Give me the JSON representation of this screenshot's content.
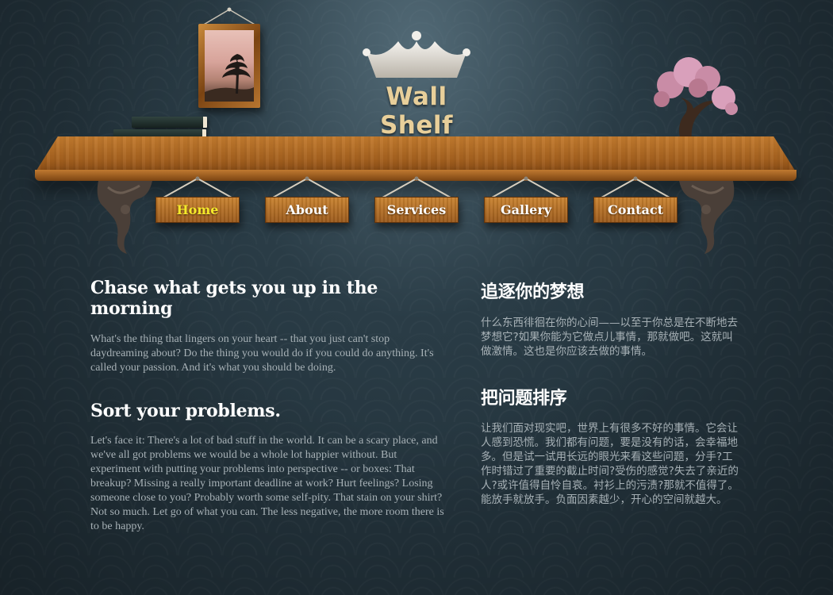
{
  "site": {
    "logo_text": "Wall Shelf",
    "logo_icon": "crown-icon"
  },
  "nav": {
    "items": [
      {
        "label": "Home",
        "active": true
      },
      {
        "label": "About",
        "active": false
      },
      {
        "label": "Services",
        "active": false
      },
      {
        "label": "Gallery",
        "active": false
      },
      {
        "label": "Contact",
        "active": false
      }
    ],
    "active_color": "#f5e92a"
  },
  "content": {
    "left": [
      {
        "heading": "Chase what gets you up in the morning",
        "body": "What's the thing that lingers on your heart -- that you just can't stop daydreaming about? Do the thing you would do if you could do anything. It's called your passion. And it's what you should be doing."
      },
      {
        "heading": "Sort your problems.",
        "body": "Let's face it: There's a lot of bad stuff in the world. It can be a scary place, and we've all got problems we would be a whole lot happier without. But experiment with putting your problems into perspective -- or boxes: That breakup? Missing a really important deadline at work? Hurt feelings? Losing someone close to you? Probably worth some self-pity. That stain on your shirt? Not so much. Let go of what you can. The less negative, the more room there is to be happy."
      }
    ],
    "right": [
      {
        "heading": "追逐你的梦想",
        "body": "什么东西徘徊在你的心间——以至于你总是在不断地去梦想它?如果你能为它做点儿事情，那就做吧。这就叫做激情。这也是你应该去做的事情。"
      },
      {
        "heading": "把问题排序",
        "body": "让我们面对现实吧，世界上有很多不好的事情。它会让人感到恐慌。我们都有问题，要是没有的话，会幸福地多。但是试一试用长远的眼光来看这些问题，分手?工作时错过了重要的截止时间?受伤的感觉?失去了亲近的人?或许值得自怜自哀。衬衫上的污渍?那就不值得了。能放手就放手。负面因素越少，开心的空间就越大。"
      }
    ]
  },
  "colors": {
    "wall": "#24343d",
    "wood": "#a5611f",
    "heading": "#ffffff",
    "body_text": "#a7b1b6"
  }
}
